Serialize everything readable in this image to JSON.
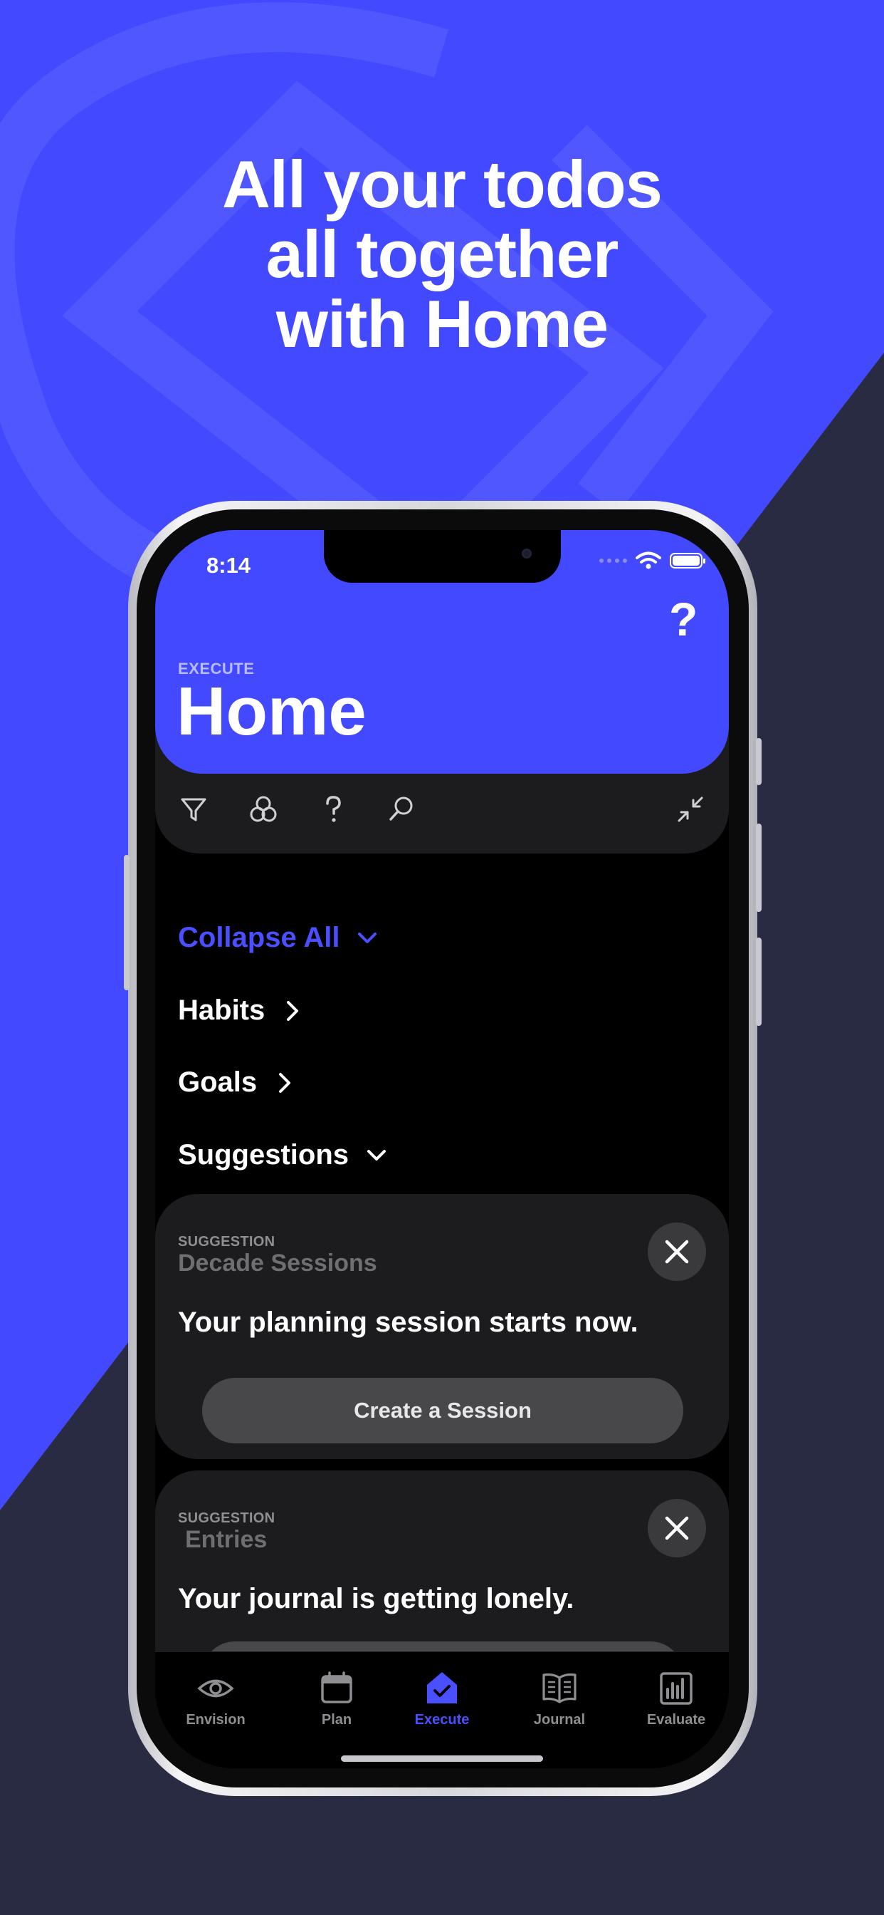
{
  "colors": {
    "accent": "#4349ff",
    "background_dark": "#2a2d45",
    "card": "#1c1c1e"
  },
  "headline": [
    "All your todos",
    "all together",
    "with Home"
  ],
  "status_bar": {
    "time": "8:14"
  },
  "header": {
    "help": "?",
    "section": "EXECUTE",
    "title": "Home"
  },
  "toolbar": {
    "icons": [
      "filter-icon",
      "circles-icon",
      "help-icon",
      "search-icon",
      "collapse-arrows-icon"
    ]
  },
  "sections": {
    "collapse_all": "Collapse All",
    "habits": "Habits",
    "goals": "Goals",
    "suggestions": "Suggestions"
  },
  "cards": [
    {
      "kicker": "SUGGESTION",
      "title": "Decade Sessions",
      "body": "Your planning session starts now.",
      "action": "Create a Session"
    },
    {
      "kicker": "SUGGESTION",
      "title": "Entries",
      "body": "Your journal is getting lonely."
    }
  ],
  "tabs": [
    {
      "label": "Envision",
      "icon": "eye-icon"
    },
    {
      "label": "Plan",
      "icon": "calendar-icon"
    },
    {
      "label": "Execute",
      "icon": "home-check-icon",
      "active": true
    },
    {
      "label": "Journal",
      "icon": "book-icon"
    },
    {
      "label": "Evaluate",
      "icon": "bar-chart-icon"
    }
  ]
}
